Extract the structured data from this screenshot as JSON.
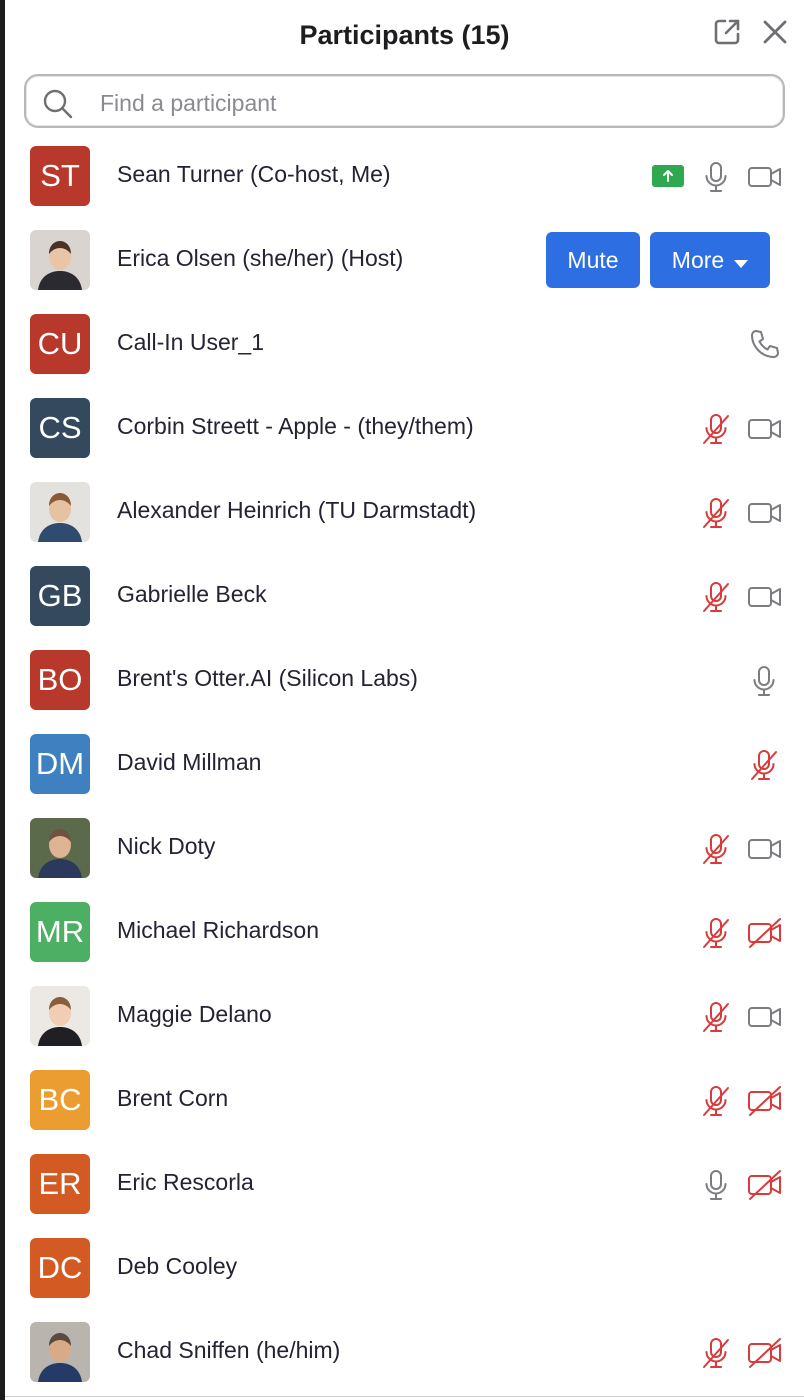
{
  "panel": {
    "title": "Participants (15)",
    "search_placeholder": "Find a participant"
  },
  "colors": {
    "primary_button": "#2d6ee3",
    "muted_red": "#d93a3a",
    "icon_gray": "#7b7b80",
    "share_green": "#2fa84f"
  },
  "participants": [
    {
      "initials": "ST",
      "name": "Sean Turner (Co-host, Me)",
      "avatar_color": "#b8392b",
      "audio": "on",
      "video": "off",
      "sharing": true
    },
    {
      "initials": "",
      "name": "Erica Olsen (she/her) (Host)",
      "photo": true,
      "hover_actions": true,
      "mute_label": "Mute",
      "more_label": "More"
    },
    {
      "initials": "CU",
      "name": "Call-In User_1",
      "avatar_color": "#b8392b",
      "audio": "phone",
      "video": "none"
    },
    {
      "initials": "CS",
      "name": "Corbin Streett - Apple - (they/them)",
      "avatar_color": "#34495e",
      "audio": "muted",
      "video": "off"
    },
    {
      "initials": "",
      "name": "Alexander Heinrich (TU Darmstadt)",
      "photo": true,
      "audio": "muted",
      "video": "off"
    },
    {
      "initials": "GB",
      "name": "Gabrielle Beck",
      "avatar_color": "#34495e",
      "audio": "muted",
      "video": "off"
    },
    {
      "initials": "BO",
      "name": "Brent's Otter.AI (Silicon Labs)",
      "avatar_color": "#b8392b",
      "audio": "on",
      "video": "none"
    },
    {
      "initials": "DM",
      "name": "David Millman",
      "avatar_color": "#3f80c0",
      "audio": "muted",
      "video": "none"
    },
    {
      "initials": "",
      "name": "Nick Doty",
      "photo": true,
      "audio": "muted",
      "video": "off"
    },
    {
      "initials": "MR",
      "name": "Michael Richardson",
      "avatar_color": "#4caf64",
      "audio": "muted",
      "video": "blocked"
    },
    {
      "initials": "",
      "name": "Maggie Delano",
      "photo": true,
      "audio": "muted",
      "video": "off"
    },
    {
      "initials": "BC",
      "name": "Brent Corn",
      "avatar_color": "#ec9d32",
      "audio": "muted",
      "video": "blocked"
    },
    {
      "initials": "ER",
      "name": "Eric Rescorla",
      "avatar_color": "#d35a22",
      "audio": "on",
      "video": "blocked"
    },
    {
      "initials": "DC",
      "name": "Deb Cooley",
      "avatar_color": "#d35a22",
      "audio": "none",
      "video": "none"
    },
    {
      "initials": "",
      "name": "Chad Sniffen (he/him)",
      "photo": true,
      "audio": "muted",
      "video": "blocked"
    }
  ]
}
